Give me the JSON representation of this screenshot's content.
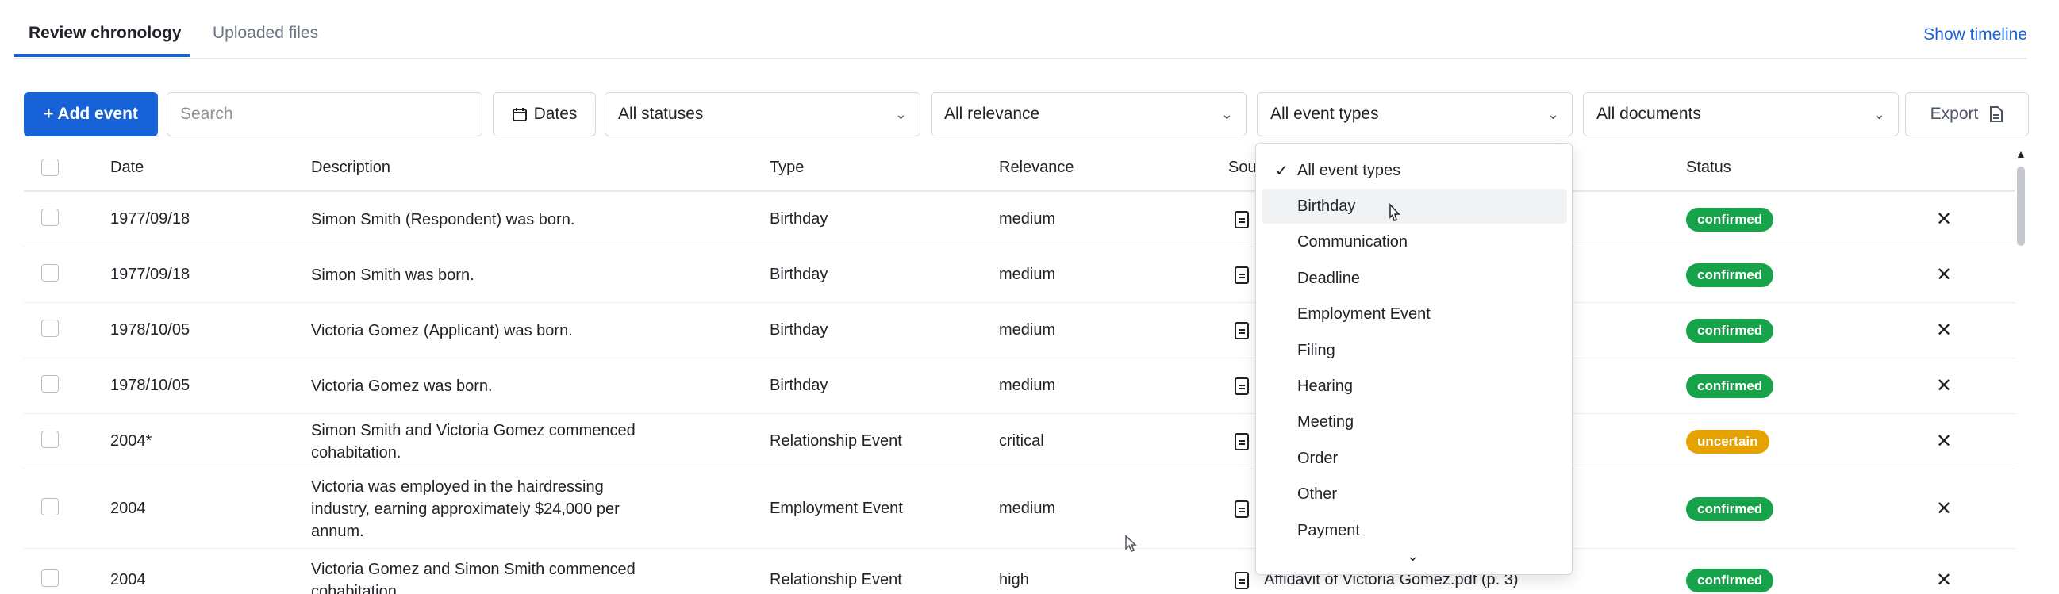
{
  "tabs": [
    {
      "label": "Review chronology",
      "active": true
    },
    {
      "label": "Uploaded files",
      "active": false
    }
  ],
  "show_timeline": "Show timeline",
  "toolbar": {
    "add_event": "+ Add event",
    "search_placeholder": "Search",
    "dates": "Dates",
    "statuses": "All statuses",
    "relevance": "All relevance",
    "event_types": "All event types",
    "documents": "All documents",
    "export": "Export"
  },
  "columns": {
    "date": "Date",
    "description": "Description",
    "type": "Type",
    "relevance": "Relevance",
    "source": "Sou",
    "status": "Status"
  },
  "rows": [
    {
      "date": "1977/09/18",
      "description": [
        "Simon Smith (Respondent) was born."
      ],
      "type": "Birthday",
      "relevance": "medium",
      "status": "confirmed"
    },
    {
      "date": "1977/09/18",
      "description": [
        "Simon Smith was born."
      ],
      "type": "Birthday",
      "relevance": "medium",
      "status": "confirmed"
    },
    {
      "date": "1978/10/05",
      "description": [
        "Victoria Gomez (Applicant) was born."
      ],
      "type": "Birthday",
      "relevance": "medium",
      "status": "confirmed"
    },
    {
      "date": "1978/10/05",
      "description": [
        "Victoria Gomez was born."
      ],
      "type": "Birthday",
      "relevance": "medium",
      "status": "confirmed"
    },
    {
      "date": "2004*",
      "description": [
        "Simon Smith and Victoria Gomez commenced",
        "cohabitation."
      ],
      "type": "Relationship Event",
      "relevance": "critical",
      "status": "uncertain"
    },
    {
      "date": "2004",
      "description": [
        "Victoria was employed in the hairdressing",
        "industry, earning approximately $24,000 per",
        "annum."
      ],
      "type": "Employment Event",
      "relevance": "medium",
      "status": "confirmed"
    },
    {
      "date": "2004",
      "description": [
        "Victoria Gomez and Simon Smith commenced",
        "cohabitation."
      ],
      "type": "Relationship Event",
      "relevance": "high",
      "status": "confirmed",
      "source": "Affidavit of Victoria Gomez.pdf (p. 3)"
    }
  ],
  "dropdown": {
    "items": [
      "All event types",
      "Birthday",
      "Communication",
      "Deadline",
      "Employment Event",
      "Filing",
      "Hearing",
      "Meeting",
      "Order",
      "Other",
      "Payment"
    ],
    "selected_index": 0,
    "hover_index": 1
  },
  "colors": {
    "accent": "#1762d6",
    "confirmed": "#16a34a",
    "uncertain": "#e6a300"
  }
}
